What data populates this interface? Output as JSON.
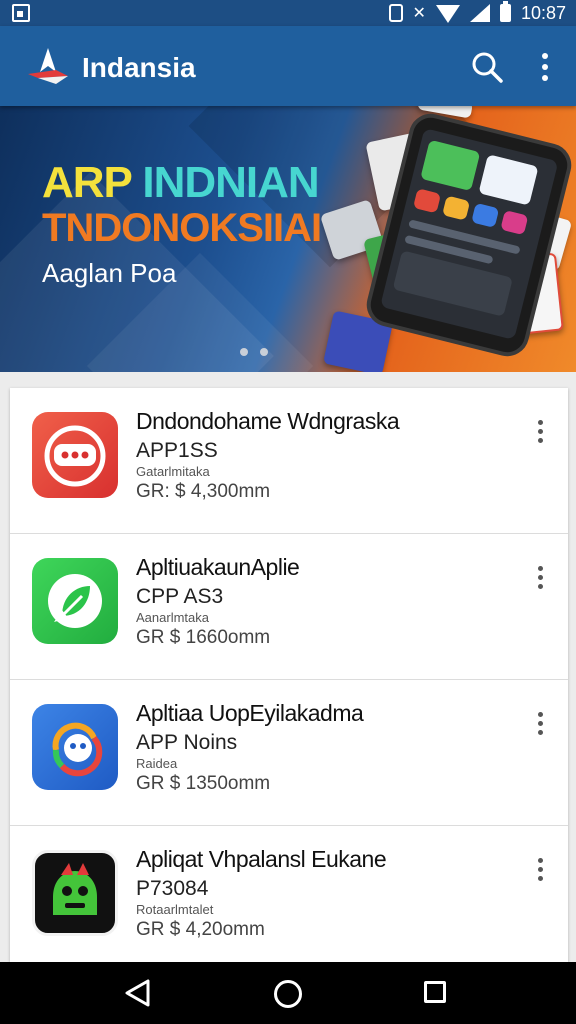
{
  "status_bar": {
    "time": "10:87"
  },
  "app_bar": {
    "title": "Indansia"
  },
  "banner": {
    "headline_word1": "ARP",
    "headline_word2": "INDNIAN",
    "headline_line2": "TNDONOKSIIAI",
    "subtitle": "Aaglan Poa"
  },
  "apps": [
    {
      "name": "Dndondohame Wdngraska",
      "subtitle": "APP1SS",
      "category": "Gatarlmitaka",
      "price": "GR: $ 4,300mm",
      "icon": "chat-bubble-app-icon",
      "color": "#e8453c"
    },
    {
      "name": "ApltiuakaunAplie",
      "subtitle": "CPP AS3",
      "category": "Aanarlmtaka",
      "price": "GR $ 1660omm",
      "icon": "leaf-app-icon",
      "color": "#2bc44a"
    },
    {
      "name": "Apltiaa UopEyilakadma",
      "subtitle": "APP Noins",
      "category": "Raidea",
      "price": "GR $ 1350omm",
      "icon": "face-app-icon",
      "color": "#2a6fd6"
    },
    {
      "name": "Apliqat Vhpalansl Eukane",
      "subtitle": "P73084",
      "category": "Rotaarlmtalet",
      "price": "GR $ 4,20omm",
      "icon": "robot-app-icon",
      "color": "#111111"
    }
  ]
}
